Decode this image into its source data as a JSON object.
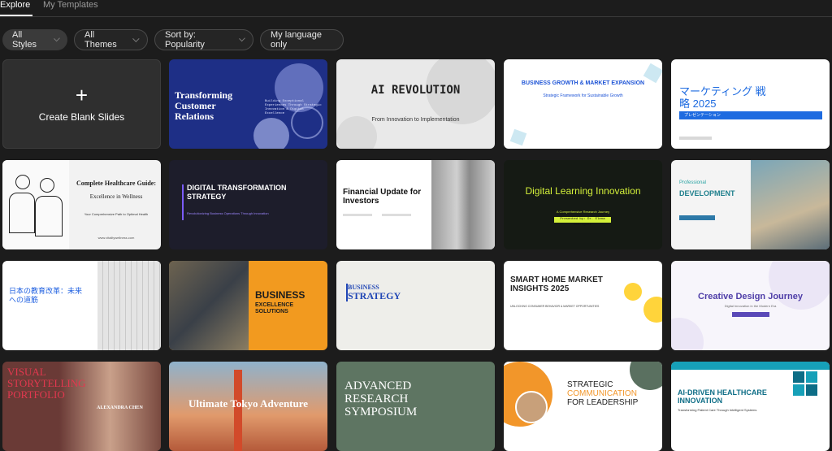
{
  "tabs": [
    {
      "label": "Explore"
    },
    {
      "label": "My Templates"
    }
  ],
  "filters": {
    "styles": "All Styles",
    "themes": "All Themes",
    "sort": "Sort by: Popularity",
    "language": "My language only"
  },
  "blank_card": {
    "icon": "+",
    "label": "Create Blank Slides"
  },
  "templates": {
    "t1": {
      "title": "Transforming Customer Relations",
      "subtitle": "Building Exceptional Experiences Through Strategic Innovation & Digital Excellence"
    },
    "t2": {
      "title": "AI REVOLUTION",
      "subtitle": "From Innovation to Implementation"
    },
    "t3": {
      "title": "BUSINESS GROWTH & MARKET EXPANSION",
      "subtitle": "Strategic Framework for Sustainable Growth"
    },
    "t4": {
      "title": "マーケティング 戦略 2025",
      "subtitle": "プレゼンテーション"
    },
    "t5": {
      "title": "Complete Healthcare Guide:",
      "title2": "Excellence in Wellness",
      "subtitle": "Your Comprehensive Path to Optimal Health",
      "url": "www.vitalitywellness.com"
    },
    "t6": {
      "title": "DIGITAL TRANSFORMATION STRATEGY",
      "subtitle": "Revolutionizing Business Operations Through Innovation"
    },
    "t7": {
      "title": "Financial Update for Investors"
    },
    "t8": {
      "title": "Digital Learning Innovation",
      "subtitle": "A Comprehensive Research Journey",
      "presenter": "Presented by: Dr. Elena Rodriguez"
    },
    "t9": {
      "label": "Professional",
      "title": "DEVELOPMENT"
    },
    "t10": {
      "title": "日本の教育改革：未来への道筋"
    },
    "t11": {
      "title": "BUSINESS",
      "title2": "EXCELLENCE",
      "title3": "SOLUTIONS"
    },
    "t12": {
      "title": "BUSINESS",
      "title2": "STRATEGY"
    },
    "t13": {
      "title": "SMART HOME MARKET INSIGHTS 2025",
      "subtitle": "UNLOCKING CONSUMER BEHAVIOR & MARKET OPPORTUNITIES"
    },
    "t14": {
      "title": "Creative Design Journey",
      "subtitle": "Digital Innovation in the Modern Era"
    },
    "t15": {
      "title": "VISUAL STORYTELLING PORTFOLIO",
      "name": "ALEXANDRA CHEN"
    },
    "t16": {
      "title": "Ultimate Tokyo Adventure"
    },
    "t17": {
      "title": "ADVANCED RESEARCH SYMPOSIUM"
    },
    "t18": {
      "title": "STRATEGIC",
      "title2": "COMMUNICATION",
      "title3": "FOR LEADERSHIP"
    },
    "t19": {
      "title": "AI-DRIVEN HEALTHCARE INNOVATION",
      "subtitle": "Transforming Patient Care Through Intelligent Systems"
    }
  }
}
